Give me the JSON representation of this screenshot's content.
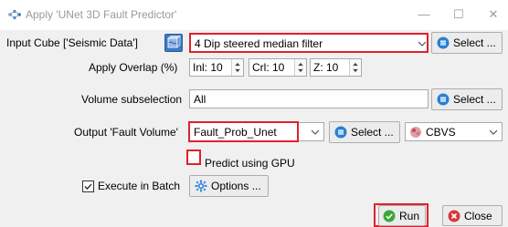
{
  "window": {
    "title": "Apply 'UNet 3D Fault Predictor'",
    "minimize_glyph": "—",
    "maximize_glyph": "☐",
    "close_glyph": "✕"
  },
  "input_cube": {
    "label": "Input Cube ['Seismic Data']",
    "value": "4 Dip steered median filter",
    "select_label": "Select ..."
  },
  "overlap": {
    "label": "Apply Overlap (%)",
    "inl": "Inl: 10",
    "crl": "Crl: 10",
    "z": "Z: 10"
  },
  "volume_subselection": {
    "label": "Volume subselection",
    "value": "All",
    "select_label": "Select ..."
  },
  "output": {
    "label": "Output 'Fault Volume'",
    "value": "Fault_Prob_Unet",
    "select_label": "Select ...",
    "format_value": "CBVS"
  },
  "predict_gpu": {
    "label": "Predict using GPU",
    "checked": false
  },
  "batch": {
    "label": "Execute in Batch",
    "checked": true,
    "options_label": "Options ..."
  },
  "actions": {
    "run_label": "Run",
    "close_label": "Close"
  },
  "colors": {
    "highlight": "#e0202e",
    "accent_blue": "#2a7fd4",
    "run_green": "#3aa83a",
    "close_red": "#d9363e"
  }
}
